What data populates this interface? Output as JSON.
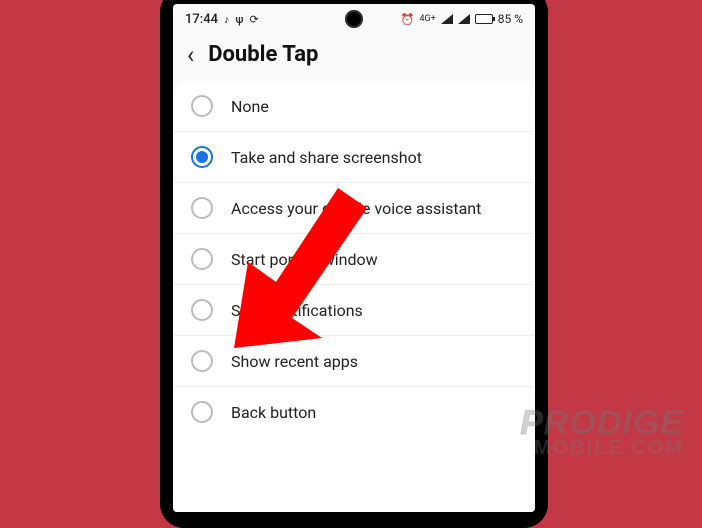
{
  "status": {
    "time": "17:44",
    "network_label": "4G+",
    "battery_pct": "85 %"
  },
  "header": {
    "title": "Double Tap"
  },
  "options": [
    {
      "label": "None",
      "selected": false
    },
    {
      "label": "Take and share screenshot",
      "selected": true
    },
    {
      "label": "Access your google voice assistant",
      "selected": false
    },
    {
      "label": "Start pop-up window",
      "selected": false
    },
    {
      "label": "Show notifications",
      "selected": false
    },
    {
      "label": "Show recent apps",
      "selected": false
    },
    {
      "label": "Back button",
      "selected": false
    }
  ],
  "watermark": {
    "line1": "PRODIGE",
    "line2": "MOBILE.COM"
  },
  "colors": {
    "page_bg": "#c43845",
    "accent": "#1a73e8",
    "arrow": "#ff0000"
  }
}
